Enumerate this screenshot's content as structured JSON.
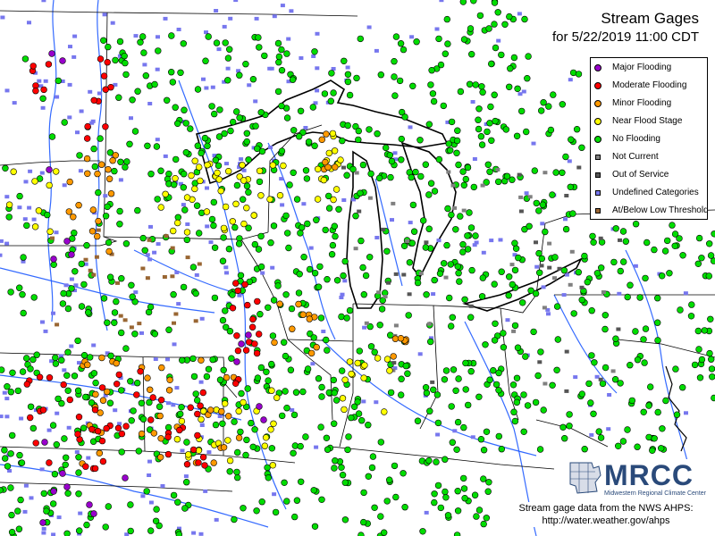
{
  "title": "Stream Gages",
  "subtitle": "for 5/22/2019 11:00 CDT",
  "legend": [
    {
      "label": "Major Flooding",
      "color": "#9900cc",
      "shape": "dot"
    },
    {
      "label": "Moderate Flooding",
      "color": "#ff0000",
      "shape": "dot"
    },
    {
      "label": "Minor Flooding",
      "color": "#ff9900",
      "shape": "dot"
    },
    {
      "label": "Near Flood Stage",
      "color": "#ffff00",
      "shape": "dot"
    },
    {
      "label": "No Flooding",
      "color": "#00dd00",
      "shape": "dot"
    },
    {
      "label": "Not Current",
      "color": "#808080",
      "shape": "square"
    },
    {
      "label": "Out of Service",
      "color": "#555555",
      "shape": "square"
    },
    {
      "label": "Undefined Categories",
      "color": "#7777ee",
      "shape": "square"
    },
    {
      "label": "At/Below Low Threshold",
      "color": "#996633",
      "shape": "square"
    }
  ],
  "logo": {
    "name": "MRCC",
    "full_name": "Midwestern Regional Climate Center",
    "accent": "#2a4a7a"
  },
  "credit": {
    "line1": "Stream gage data from the NWS AHPS:",
    "line2": "http://water.weather.gov/ahps"
  },
  "colors": {
    "water": "#1e5aff",
    "boundary_state": "#000000",
    "lake_outline": "#000000"
  }
}
